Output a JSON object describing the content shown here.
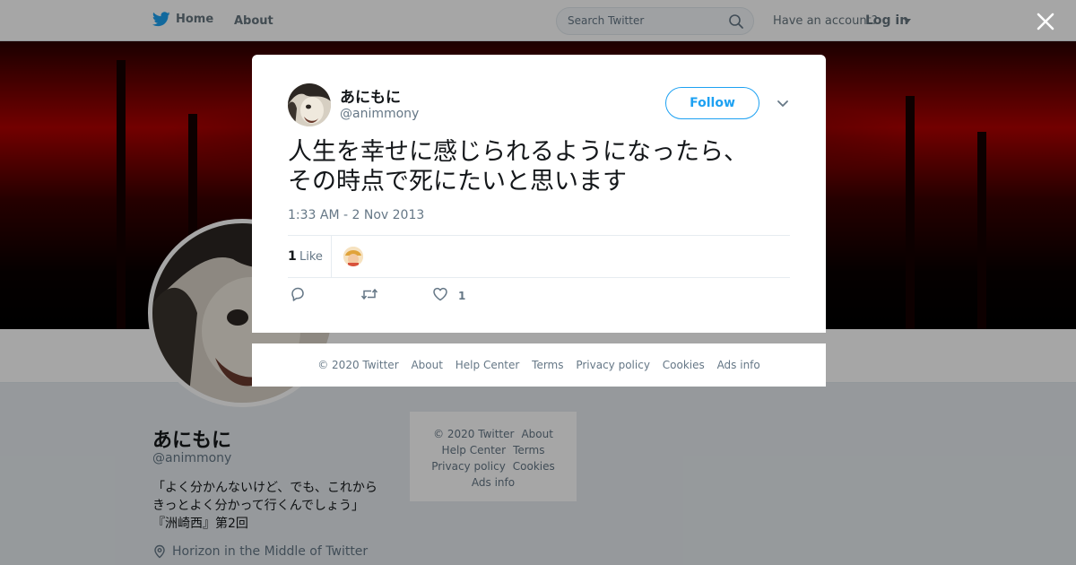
{
  "topbar": {
    "home_label": "Home",
    "about_label": "About",
    "search_placeholder": "Search Twitter",
    "have_account": "Have an account?",
    "login_label": "Log in"
  },
  "profile": {
    "name": "あにもに",
    "handle": "@animmony",
    "bio_line1": "「よく分かんないけど、でも、これから",
    "bio_line2": "きっとよく分かって行くんでしょう」",
    "bio_line3": "『洲崎西』第2回",
    "location": "Horizon in the Middle of Twitter"
  },
  "side_footer": {
    "copyright": "© 2020 Twitter",
    "about": "About",
    "help": "Help Center",
    "terms": "Terms",
    "privacy": "Privacy policy",
    "cookies": "Cookies",
    "ads": "Ads info"
  },
  "tweet": {
    "author_name": "あにもに",
    "author_handle": "@animmony",
    "follow_label": "Follow",
    "text_line1": "人生を幸せに感じられるようになったら、",
    "text_line2": "その時点で死にたいと思います",
    "timestamp": "1:33 AM - 2 Nov 2013",
    "like_count": "1",
    "like_label": "Like",
    "heart_count": "1"
  },
  "modal_footer": {
    "copyright": "© 2020 Twitter",
    "about": "About",
    "help": "Help Center",
    "terms": "Terms",
    "privacy": "Privacy policy",
    "cookies": "Cookies",
    "ads": "Ads info"
  },
  "colors": {
    "accent": "#1da1f2",
    "muted_text": "#657786",
    "overlay": "rgba(0,0,0,0.35)",
    "banner_red": "#b00000"
  },
  "icons": [
    "twitter-bird-icon",
    "search-icon",
    "caret-down-icon",
    "close-icon",
    "chevron-down-icon",
    "reply-icon",
    "retweet-icon",
    "heart-icon",
    "location-icon"
  ]
}
